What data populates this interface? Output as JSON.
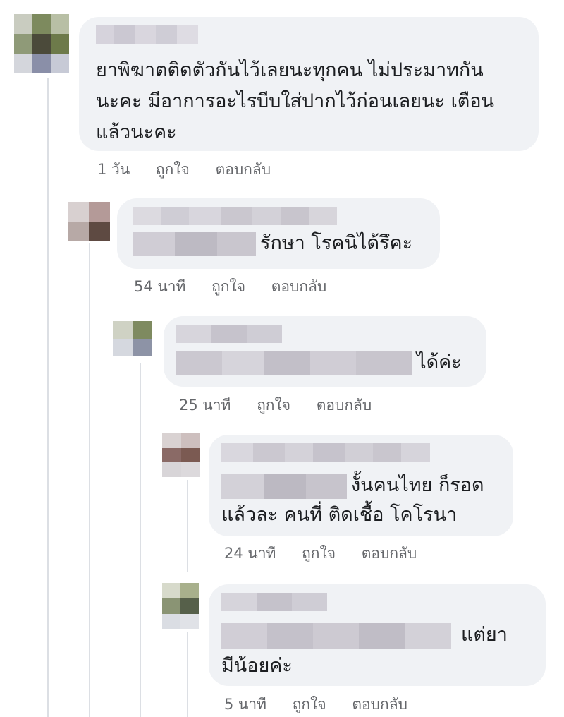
{
  "comments": [
    {
      "text_lines": [
        "ยาพิฆาตติดตัวกันไว้เลยนะทุกคน ไม่ประมาทกัน",
        "นะคะ มีอาการอะไรบีบใส่ปากไว้ก่อนเลยนะ เตือน",
        "แล้วนะคะ"
      ],
      "time": "1 วัน",
      "like": "ถูกใจ",
      "reply": "ตอบกลับ"
    },
    {
      "text_lines": [
        "รักษา โรคนิได้รึคะ"
      ],
      "time": "54 นาที",
      "like": "ถูกใจ",
      "reply": "ตอบกลับ"
    },
    {
      "text_lines": [
        "ได้ค่ะ"
      ],
      "time": "25 นาที",
      "like": "ถูกใจ",
      "reply": "ตอบกลับ"
    },
    {
      "text_lines": [
        "งั้นคนไทย ก็รอด",
        "แล้วละ คนที่ ติดเชื้อ โคโรนา"
      ],
      "time": "24 นาที",
      "like": "ถูกใจ",
      "reply": "ตอบกลับ"
    },
    {
      "text_lines": [
        "แต่ยา",
        "มีน้อยค่ะ"
      ],
      "time": "5 นาที",
      "like": "ถูกใจ",
      "reply": "ตอบกลับ"
    }
  ],
  "colors": {
    "bubble": "#f0f2f5",
    "meta_text": "#65676b",
    "thread_line": "#dcdfe4"
  }
}
